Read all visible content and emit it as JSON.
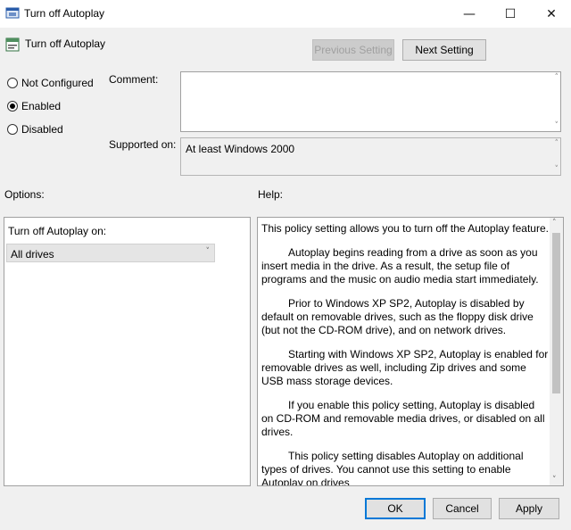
{
  "window": {
    "title": "Turn off Autoplay",
    "minimize_glyph": "—",
    "maximize_glyph": "☐",
    "close_glyph": "✕"
  },
  "header": {
    "setting_name": "Turn off Autoplay",
    "previous_label": "Previous Setting",
    "next_label": "Next Setting"
  },
  "state": {
    "options": [
      {
        "label": "Not Configured",
        "selected": false
      },
      {
        "label": "Enabled",
        "selected": true
      },
      {
        "label": "Disabled",
        "selected": false
      }
    ]
  },
  "comment": {
    "label": "Comment:",
    "value": ""
  },
  "supported": {
    "label": "Supported on:",
    "value": "At least Windows 2000"
  },
  "options_panel": {
    "heading": "Options:",
    "dropdown_label": "Turn off Autoplay on:",
    "dropdown_value": "All drives"
  },
  "help_panel": {
    "heading": "Help:",
    "paragraphs": [
      "This policy setting allows you to turn off the Autoplay feature.",
      "Autoplay begins reading from a drive as soon as you insert media in the drive. As a result, the setup file of programs and the music on audio media start immediately.",
      "Prior to Windows XP SP2, Autoplay is disabled by default on removable drives, such as the floppy disk drive (but not the CD-ROM drive), and on network drives.",
      "Starting with Windows XP SP2, Autoplay is enabled for removable drives as well, including Zip drives and some USB mass storage devices.",
      "If you enable this policy setting, Autoplay is disabled on CD-ROM and removable media drives, or disabled on all drives.",
      "This policy setting disables Autoplay on additional types of drives. You cannot use this setting to enable Autoplay on drives"
    ]
  },
  "footer": {
    "ok_label": "OK",
    "cancel_label": "Cancel",
    "apply_label": "Apply"
  },
  "colors": {
    "accent": "#0078d7",
    "background": "#f0f0f0"
  }
}
